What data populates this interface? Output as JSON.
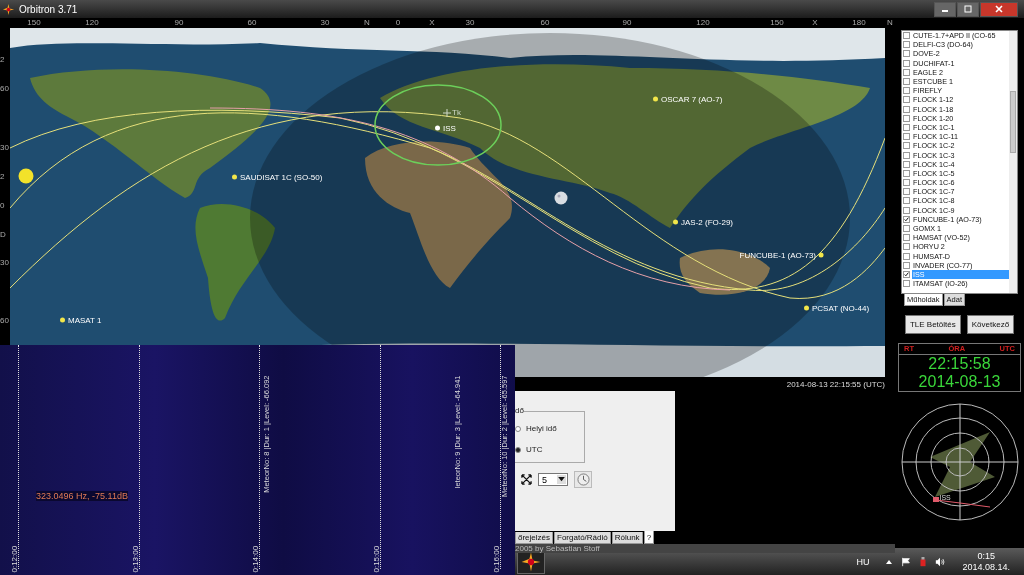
{
  "window": {
    "title": "Orbitron 3.71"
  },
  "longitude_labels": [
    "150",
    "120",
    "90",
    "60",
    "30",
    "N",
    "0",
    "X",
    "30",
    "60",
    "90",
    "120",
    "150",
    "X",
    "180",
    "N"
  ],
  "latitude_labels": [
    "2",
    "60",
    "30",
    "2",
    "0",
    "D",
    "30",
    "60"
  ],
  "map": {
    "observer": "Tk",
    "satellites": [
      {
        "name": "OSCAR 7 (AO-7)",
        "color": "#f2e64a"
      },
      {
        "name": "ISS",
        "color": "#ffffff"
      },
      {
        "name": "SAUDISAT 1C (SO-50)",
        "color": "#f2e64a"
      },
      {
        "name": "JAS-2 (FO-29)",
        "color": "#f2e64a"
      },
      {
        "name": "FUNCUBE-1 (AO-73)",
        "color": "#f2e64a"
      },
      {
        "name": "PCSAT (NO-44)",
        "color": "#f2e64a"
      },
      {
        "name": "MASAT 1",
        "color": "#f2e64a"
      }
    ]
  },
  "timestamp": "2014-08-13 22:15:55 (UTC)",
  "satellite_list": [
    {
      "name": "CUTE-1.7+APD II (CO-65",
      "checked": false,
      "selected": false
    },
    {
      "name": "DELFI-C3 (DO-64)",
      "checked": false,
      "selected": false
    },
    {
      "name": "DOVE-2",
      "checked": false,
      "selected": false
    },
    {
      "name": "DUCHIFAT-1",
      "checked": false,
      "selected": false
    },
    {
      "name": "EAGLE 2",
      "checked": false,
      "selected": false
    },
    {
      "name": "ESTCUBE 1",
      "checked": false,
      "selected": false
    },
    {
      "name": "FIREFLY",
      "checked": false,
      "selected": false
    },
    {
      "name": "FLOCK 1-12",
      "checked": false,
      "selected": false
    },
    {
      "name": "FLOCK 1-18",
      "checked": false,
      "selected": false
    },
    {
      "name": "FLOCK 1-20",
      "checked": false,
      "selected": false
    },
    {
      "name": "FLOCK 1C-1",
      "checked": false,
      "selected": false
    },
    {
      "name": "FLOCK 1C-11",
      "checked": false,
      "selected": false
    },
    {
      "name": "FLOCK 1C-2",
      "checked": false,
      "selected": false
    },
    {
      "name": "FLOCK 1C-3",
      "checked": false,
      "selected": false
    },
    {
      "name": "FLOCK 1C-4",
      "checked": false,
      "selected": false
    },
    {
      "name": "FLOCK 1C-5",
      "checked": false,
      "selected": false
    },
    {
      "name": "FLOCK 1C-6",
      "checked": false,
      "selected": false
    },
    {
      "name": "FLOCK 1C-7",
      "checked": false,
      "selected": false
    },
    {
      "name": "FLOCK 1C-8",
      "checked": false,
      "selected": false
    },
    {
      "name": "FLOCK 1C-9",
      "checked": false,
      "selected": false
    },
    {
      "name": "FUNCUBE-1 (AO-73)",
      "checked": true,
      "selected": false
    },
    {
      "name": "GOMX 1",
      "checked": false,
      "selected": false
    },
    {
      "name": "HAMSAT (VO-52)",
      "checked": false,
      "selected": false
    },
    {
      "name": "HORYU 2",
      "checked": false,
      "selected": false
    },
    {
      "name": "HUMSAT-D",
      "checked": false,
      "selected": false
    },
    {
      "name": "INVADER (CO-77)",
      "checked": false,
      "selected": false
    },
    {
      "name": "ISS",
      "checked": true,
      "selected": true
    },
    {
      "name": "ITAMSAT (IO-26)",
      "checked": false,
      "selected": false
    }
  ],
  "list_tabs": [
    {
      "label": "Műholdak",
      "selected": true
    },
    {
      "label": "Adat",
      "selected": false
    }
  ],
  "buttons": [
    "TLE Betöltés",
    "Következő"
  ],
  "clock": {
    "labels": [
      "RT",
      "ÓRA",
      "UTC"
    ],
    "time": "22:15:58",
    "date": "2014-08-13"
  },
  "radar": {
    "satellite": "ISS"
  },
  "settings_panel": {
    "group_label": "dő",
    "radios": [
      {
        "label": "Helyi idő",
        "selected": false
      },
      {
        "label": "UTC",
        "selected": true
      }
    ],
    "step": "5",
    "tabs": [
      {
        "label": "őrejelzés",
        "selected": false
      },
      {
        "label": "Forgató/Rádió",
        "selected": false
      },
      {
        "label": "Rólunk",
        "selected": false
      },
      {
        "label": "?",
        "selected": true
      }
    ]
  },
  "status_bar": "2005 by Sebastian Stoff",
  "waterfall": {
    "time_labels": [
      "0:12:00",
      "0:13:00",
      "0:14:00",
      "0:15:00",
      "0:16:00"
    ],
    "readout": "323.0496 Hz, -75.11dB",
    "meteor_labels": [
      "MeteorNo: 8 |Dur: 1 |Level: -66.092",
      "leteorNo: 9 |Dur: 3 |Level: -64.941",
      "MeteorNo: 10 |Dur: 2 |Level: -65.597"
    ]
  },
  "taskbar": {
    "language": "HU",
    "time": "0:15",
    "date": "2014.08.14."
  }
}
